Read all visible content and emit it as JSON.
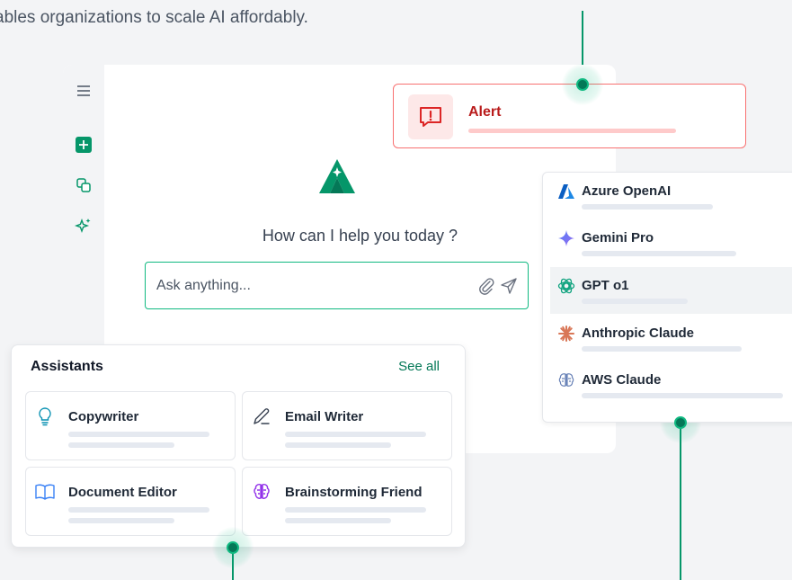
{
  "intro_text": "ables organizations to scale AI affordably.",
  "colors": {
    "accent": "#047857",
    "alert": "#b91c1c",
    "alert_border": "#f87171"
  },
  "sidebar": {
    "icons": [
      "menu-icon",
      "new-chat-icon",
      "copy-icon",
      "sparkle-icon"
    ]
  },
  "chat": {
    "prompt_title": "How can I help you today ?",
    "input_placeholder": "Ask anything...",
    "icons": [
      "attach-icon",
      "send-icon"
    ]
  },
  "alert": {
    "title": "Alert",
    "icon": "alert-icon"
  },
  "models": {
    "items": [
      {
        "name": "Azure OpenAI",
        "icon": "azure-logo-icon"
      },
      {
        "name": "Gemini Pro",
        "icon": "gemini-logo-icon"
      },
      {
        "name": "GPT o1",
        "icon": "openai-logo-icon",
        "selected": true
      },
      {
        "name": "Anthropic Claude",
        "icon": "anthropic-logo-icon"
      },
      {
        "name": "AWS Claude",
        "icon": "aws-brain-icon"
      }
    ]
  },
  "assistants": {
    "title": "Assistants",
    "see_all": "See all",
    "tiles": [
      {
        "name": "Copywriter",
        "icon": "lightbulb-icon"
      },
      {
        "name": "Email Writer",
        "icon": "pen-icon"
      },
      {
        "name": "Document Editor",
        "icon": "book-icon"
      },
      {
        "name": "Brainstorming Friend",
        "icon": "brain-icon"
      }
    ]
  }
}
